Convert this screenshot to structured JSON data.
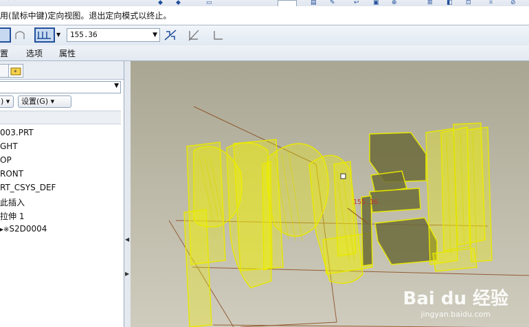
{
  "message_bar": {
    "text": "用(鼠标中键)定向视图。退出定向模式以终止。"
  },
  "dashboard": {
    "value_combo": "155.36",
    "colors": {
      "active_button_border": "#1f4e9a",
      "active_button_bg": "#c7d9f1"
    }
  },
  "tabs": [
    {
      "label": "置"
    },
    {
      "label": "选项"
    },
    {
      "label": "属性"
    }
  ],
  "left_panel": {
    "buttons": [
      {
        "label": ")"
      },
      {
        "label": "设置(G)"
      }
    ],
    "tree": [
      {
        "label": "003.PRT",
        "icon": "none"
      },
      {
        "label": "GHT",
        "icon": "none"
      },
      {
        "label": "OP",
        "icon": "none"
      },
      {
        "label": "RONT",
        "icon": "none"
      },
      {
        "label": "RT_CSYS_DEF",
        "icon": "none"
      },
      {
        "label": "此插入",
        "icon": "none"
      },
      {
        "label": "拉伸 1",
        "icon": "none"
      },
      {
        "label": "S2D0004",
        "icon": "sketch-icon"
      }
    ]
  },
  "viewport": {
    "dimension_label": "155.36",
    "highlight_color": "#f2f200",
    "background_top": "#a9a692",
    "background_bottom": "#cfccbe"
  },
  "watermark": {
    "logo": "Bai du 经验",
    "url": "jingyan.baidu.com"
  }
}
